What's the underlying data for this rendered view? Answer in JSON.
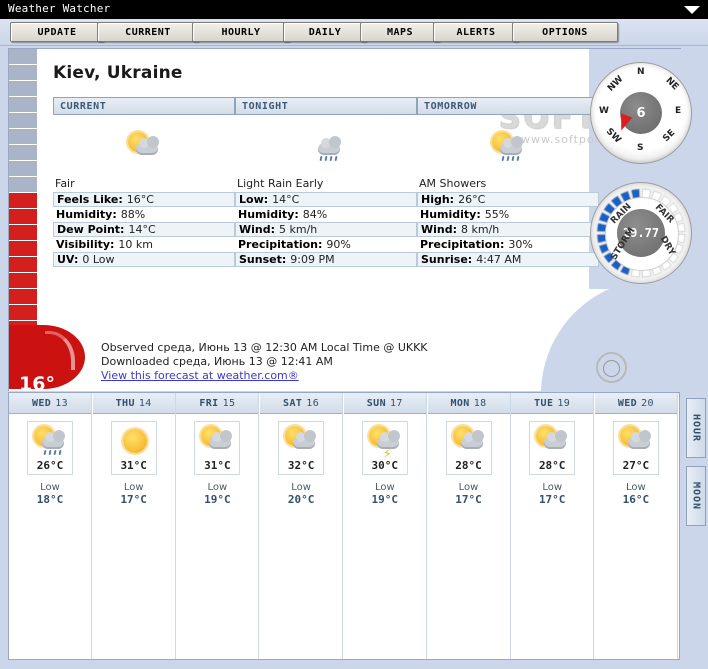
{
  "window": {
    "title": "Weather Watcher",
    "dropdown_icon": "chevron-down-icon"
  },
  "toolbar": {
    "buttons": [
      {
        "label": "UPDATE"
      },
      {
        "label": "CURRENT"
      },
      {
        "label": "HOURLY"
      },
      {
        "label": "DAILY"
      },
      {
        "label": "MAPS"
      },
      {
        "label": "ALERTS"
      },
      {
        "label": "OPTIONS"
      }
    ]
  },
  "location": {
    "name": "Kiev, Ukraine"
  },
  "current_temp_badge": "16°",
  "watermark": {
    "brand": "SOFTPORTAL",
    "url": "www.softportal.com"
  },
  "columns": [
    {
      "header": "CURRENT",
      "icon": "haze-sun-icon",
      "condition": "Fair",
      "rows": [
        {
          "label": "Feels Like:",
          "value": "16°C"
        },
        {
          "label": "Humidity:",
          "value": "88%"
        },
        {
          "label": "Dew Point:",
          "value": "14°C"
        },
        {
          "label": "Visibility:",
          "value": "10 km"
        },
        {
          "label": "UV:",
          "value": "0 Low"
        }
      ]
    },
    {
      "header": "TONIGHT",
      "icon": "rain-cloud-icon",
      "condition": "Light Rain Early",
      "rows": [
        {
          "label": "Low:",
          "value": "14°C"
        },
        {
          "label": "Humidity:",
          "value": "84%"
        },
        {
          "label": "Wind:",
          "value": "5 km/h"
        },
        {
          "label": "Precipitation:",
          "value": "90%"
        },
        {
          "label": "Sunset:",
          "value": "9:09 PM"
        }
      ]
    },
    {
      "header": "TOMORROW",
      "icon": "sun-rain-cloud-icon",
      "condition": "AM Showers",
      "rows": [
        {
          "label": "High:",
          "value": "26°C"
        },
        {
          "label": "Humidity:",
          "value": "55%"
        },
        {
          "label": "Wind:",
          "value": "8 km/h"
        },
        {
          "label": "Precipitation:",
          "value": "30%"
        },
        {
          "label": "Sunrise:",
          "value": "4:47 AM"
        }
      ]
    }
  ],
  "compass": {
    "value": "6",
    "directions": [
      "N",
      "NE",
      "E",
      "SE",
      "S",
      "SW",
      "W",
      "NW"
    ],
    "needle_direction": "SW",
    "needle_color": "#e01b1b"
  },
  "barometer": {
    "value": "29.77",
    "labels": [
      "RAIN",
      "FAIR",
      "DRY",
      "STORM"
    ],
    "segment_color": "#1b5fc4"
  },
  "observation": {
    "observed": "Observed среда, Июнь 13 @ 12:30 AM Local Time @ UKKK",
    "downloaded": "Downloaded среда, Июнь 13 @ 12:41 AM",
    "link": "View this forecast at weather.com®",
    "moon_icon": "moon-phase-icon"
  },
  "forecast": {
    "days": [
      {
        "dow": "WED",
        "date": "13",
        "icon": "rain-cloud-sun-icon",
        "high": "26°C",
        "low_label": "Low",
        "low": "18°C"
      },
      {
        "dow": "THU",
        "date": "14",
        "icon": "sun-icon",
        "high": "31°C",
        "low_label": "Low",
        "low": "17°C"
      },
      {
        "dow": "FRI",
        "date": "15",
        "icon": "sun-cloud-icon",
        "high": "31°C",
        "low_label": "Low",
        "low": "19°C"
      },
      {
        "dow": "SAT",
        "date": "16",
        "icon": "sun-cloud-icon",
        "high": "32°C",
        "low_label": "Low",
        "low": "20°C"
      },
      {
        "dow": "SUN",
        "date": "17",
        "icon": "thunderstorm-icon",
        "high": "30°C",
        "low_label": "Low",
        "low": "19°C"
      },
      {
        "dow": "MON",
        "date": "18",
        "icon": "sun-cloud-icon",
        "high": "28°C",
        "low_label": "Low",
        "low": "17°C"
      },
      {
        "dow": "TUE",
        "date": "19",
        "icon": "sun-cloud-icon",
        "high": "28°C",
        "low_label": "Low",
        "low": "17°C"
      },
      {
        "dow": "WED",
        "date": "20",
        "icon": "sun-cloud-icon",
        "high": "27°C",
        "low_label": "Low",
        "low": "16°C"
      }
    ]
  },
  "side_tabs": [
    {
      "label": "HOUR"
    },
    {
      "label": "MOON"
    }
  ]
}
